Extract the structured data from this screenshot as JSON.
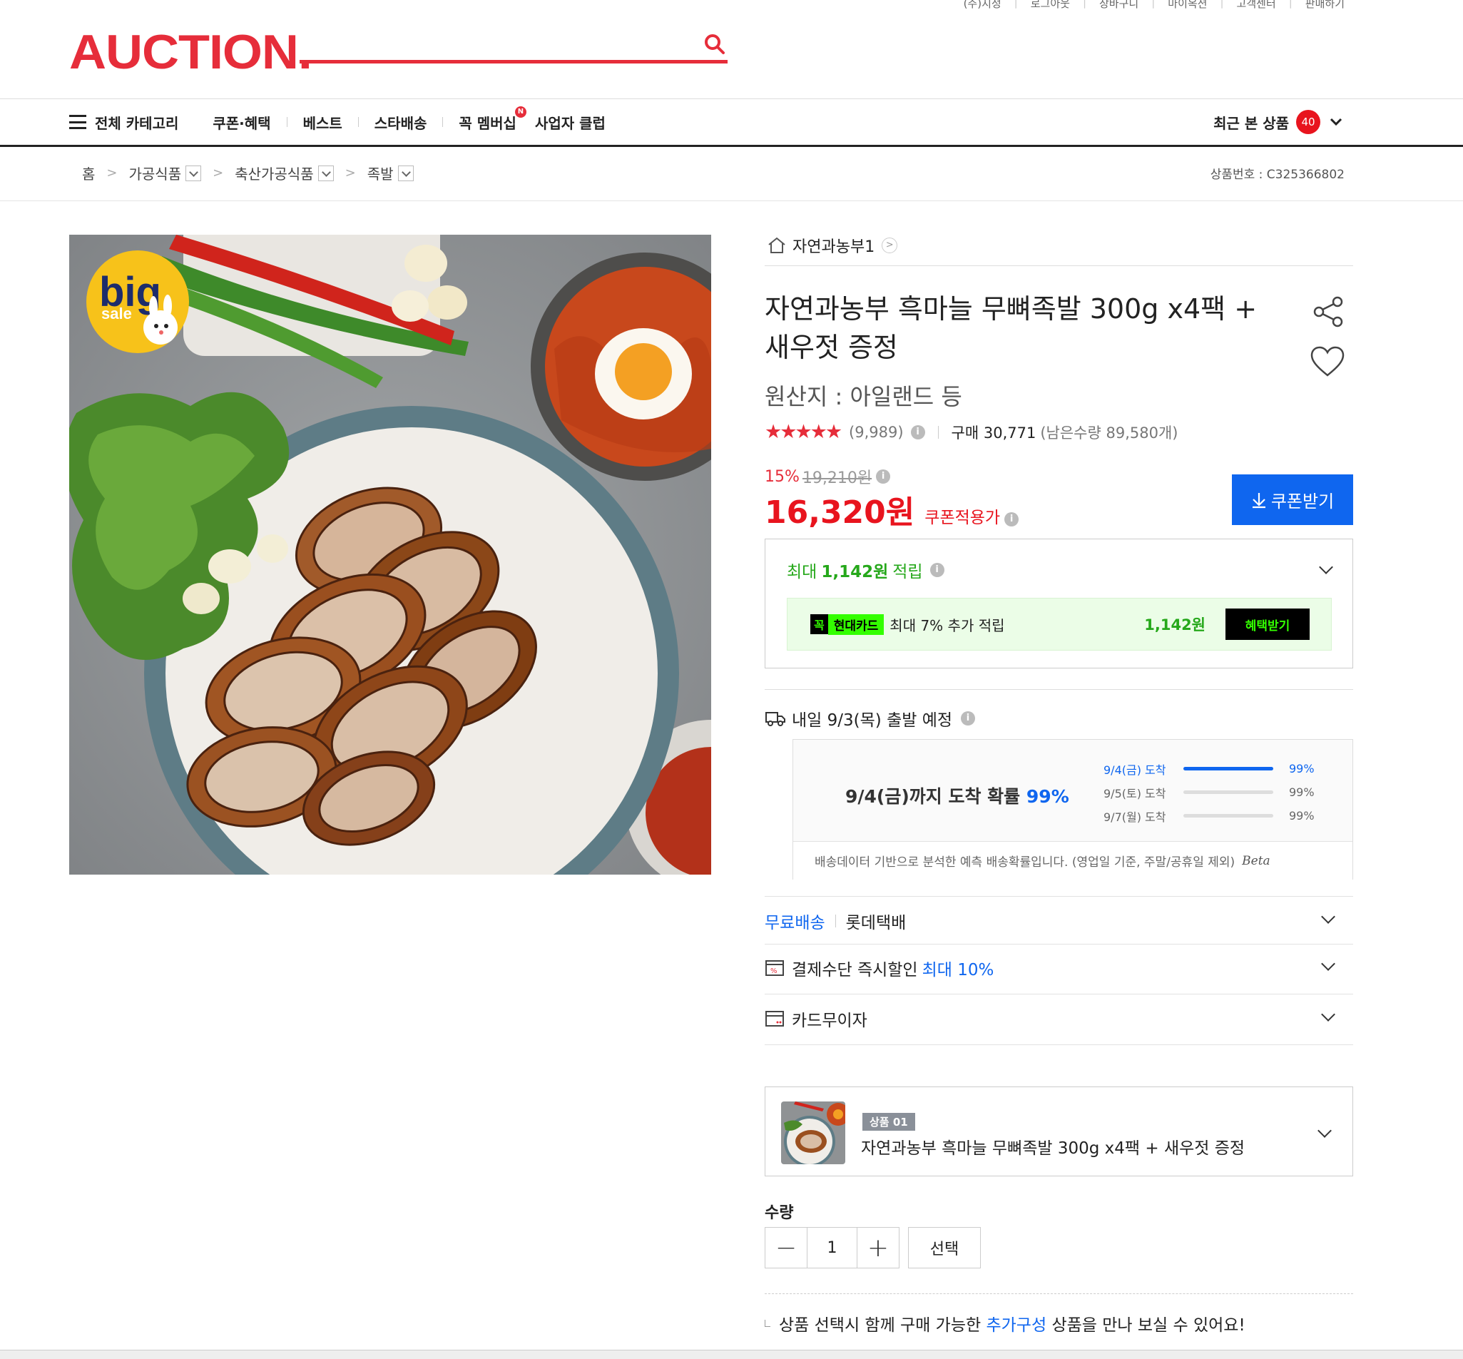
{
  "util_links": [
    "(주)지정",
    "로그아웃",
    "장바구니",
    "마이옥션",
    "고객센터",
    "판매하기"
  ],
  "logo_text": "AUCTION.",
  "nav": {
    "all_categories": "전체 카테고리",
    "items": [
      "쿠폰·혜택",
      "베스트",
      "스타배송",
      "꼭 멤버십",
      "사업자 클럽"
    ],
    "membership_badge": "N",
    "recent_label": "최근 본 상품",
    "recent_count": "40"
  },
  "breadcrumb": {
    "home": "홈",
    "cat1": "가공식품",
    "cat2": "축산가공식품",
    "cat3": "족발"
  },
  "product_code": "상품번호 : C325366802",
  "image_badge": {
    "line1": "big",
    "line2": "sale"
  },
  "seller": "자연과농부1",
  "title": "자연과농부 흑마늘 무뼈족발 300g x4팩 + 새우젓 증정",
  "origin": "원산지 : 아일랜드 등",
  "rating": {
    "stars": "★★★★★",
    "reviews": "(9,989)",
    "purchase": "구매 30,771",
    "remaining": "(남은수량 89,580개)"
  },
  "discount": {
    "percent": "15%",
    "original": "19,210원"
  },
  "price": {
    "value": "16,320원",
    "label": "쿠폰적용가"
  },
  "coupon_button": "쿠폰받기",
  "reward": {
    "prefix": "최대",
    "amount": "1,142원",
    "suffix": "적립",
    "card_brand_k": "꼭",
    "card_brand": "현대카드",
    "card_text": "최대 7% 추가 적립",
    "card_amount": "1,142원",
    "card_button": "혜택받기"
  },
  "shipping": {
    "departure": "내일 9/3(목) 출발 예정",
    "prob_headline_pre": "9/4(금)까지 도착 확률",
    "prob_headline_pct": "99%",
    "rows": [
      {
        "date": "9/4(금) 도착",
        "pct": "99%",
        "fill": 1.0
      },
      {
        "date": "9/5(토) 도착",
        "pct": "99%",
        "fill": 0
      },
      {
        "date": "9/7(월) 도착",
        "pct": "99%",
        "fill": 0
      }
    ],
    "note": "배송데이터 기반으로 분석한 예측 배송확률입니다. (영업일 기준, 주말/공휴일 제외)",
    "beta": "Beta"
  },
  "options": {
    "free_ship": "무료배송",
    "courier": "롯데택배",
    "payment": "결제수단 즉시할인",
    "payment_max": "최대 10%",
    "installment": "카드무이자"
  },
  "selection": {
    "tag": "상품 01",
    "name": "자연과농부 흑마늘 무뼈족발 300g x4팩 + 새우젓 증정"
  },
  "quantity": {
    "label": "수량",
    "value": "1",
    "minus": "−",
    "plus": "+",
    "select": "선택"
  },
  "addon": {
    "pre": "상품 선택시 함께 구매 가능한",
    "link": "추가구성",
    "post": "상품을 만나 보실 수 있어요!"
  }
}
